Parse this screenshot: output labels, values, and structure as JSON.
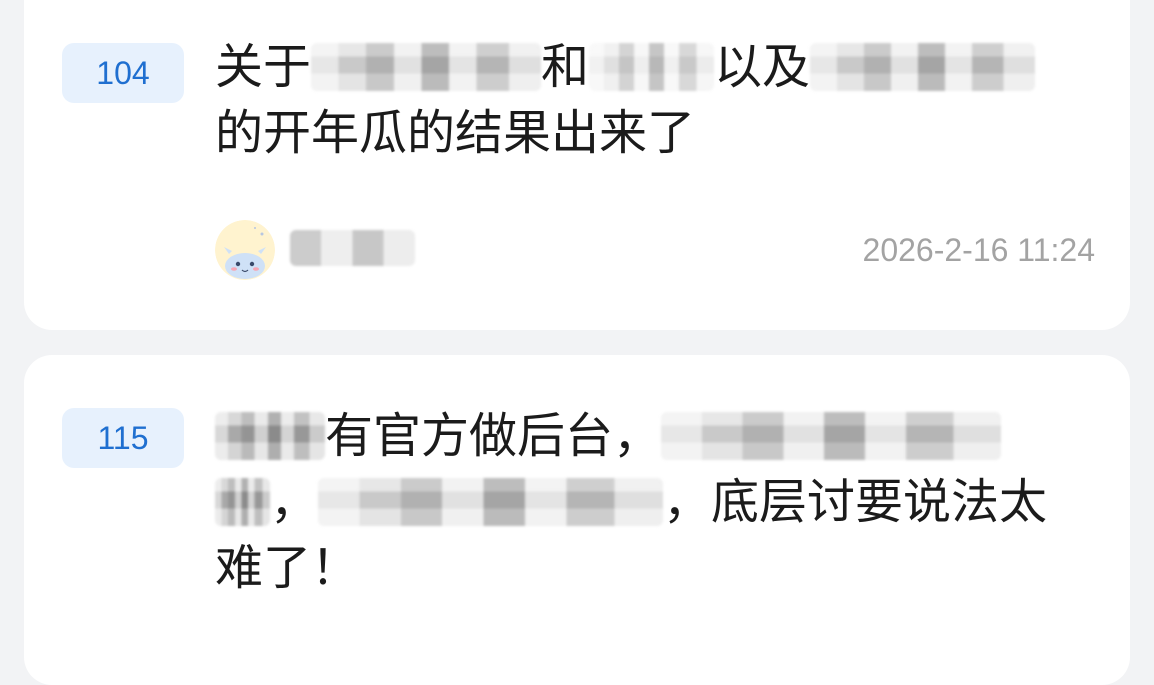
{
  "posts": [
    {
      "rank": "104",
      "title_parts": {
        "a": "关于",
        "b": "和",
        "c": "以及",
        "d": "的开年瓜的结果出来了"
      },
      "timestamp": "2026-2-16 11:24",
      "avatar_icon": "dragon-avatar-icon"
    },
    {
      "rank": "115",
      "title_parts": {
        "a": "有官方做后台，",
        "b": "，",
        "c": "，底层讨要说法太难了！"
      }
    }
  ],
  "colors": {
    "background": "#f2f3f5",
    "card": "#ffffff",
    "rank_bg": "#e7f1fd",
    "rank_text": "#1f6fd0",
    "title_text": "#1b1b1b",
    "timestamp_text": "#a3a3a3"
  }
}
